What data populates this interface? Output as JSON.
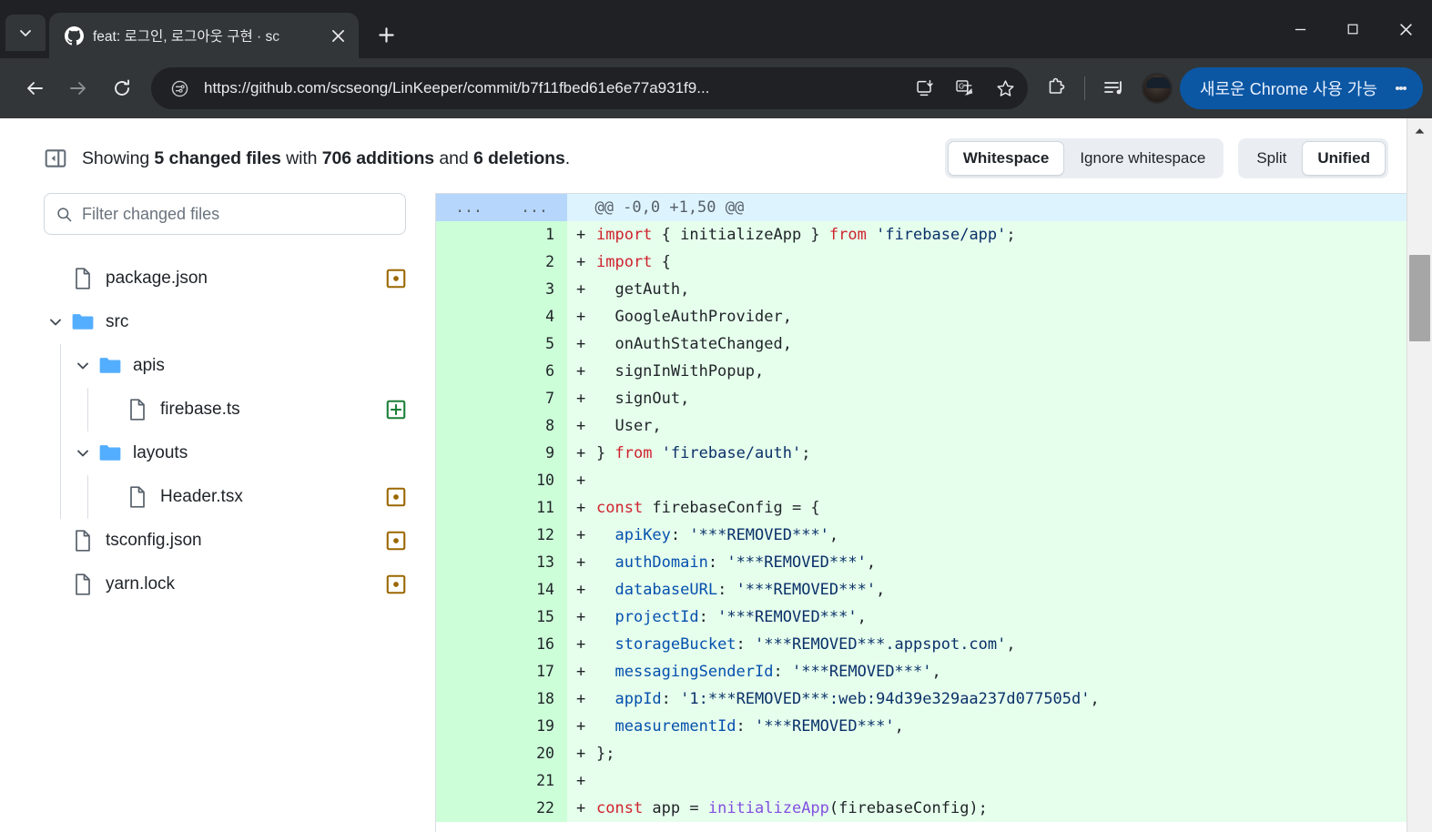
{
  "browser": {
    "tab": {
      "title": "feat: 로그인, 로그아웃 구현 · sc",
      "favicon": "github-icon"
    },
    "new_tab_label": "+",
    "omnibox": {
      "url": "https://github.com/scseong/LinKeeper/commit/b7f11fbed61e6e77a931f9...",
      "site_info_icon": "page-info-icon"
    },
    "toolbar_icons": [
      "install-app-icon",
      "translate-icon",
      "bookmark-star-icon",
      "extensions-icon",
      "media-controls-icon"
    ],
    "profile": "profile-avatar",
    "new_chrome_button": "새로운 Chrome 사용 가능",
    "window_controls": {
      "minimize": "minimize-icon",
      "maximize": "maximize-icon",
      "close": "close-icon"
    }
  },
  "header": {
    "summary_prefix": "Showing ",
    "changed_files": "5 changed files",
    "summary_mid": " with ",
    "additions": "706 additions",
    "summary_and": " and ",
    "deletions": "6 deletions",
    "summary_end": ".",
    "whitespace_group": [
      {
        "label": "Whitespace",
        "active": true
      },
      {
        "label": "Ignore whitespace",
        "active": false
      }
    ],
    "view_group": [
      {
        "label": "Split",
        "active": false
      },
      {
        "label": "Unified",
        "active": true
      }
    ]
  },
  "sidebar": {
    "filter_placeholder": "Filter changed files",
    "items": [
      {
        "name": "package.json",
        "type": "file",
        "depth": 0,
        "status": "modified"
      },
      {
        "name": "src",
        "type": "folder",
        "depth": 0,
        "expanded": true,
        "status": "none"
      },
      {
        "name": "apis",
        "type": "folder",
        "depth": 1,
        "expanded": true,
        "status": "none"
      },
      {
        "name": "firebase.ts",
        "type": "file",
        "depth": 2,
        "status": "added"
      },
      {
        "name": "layouts",
        "type": "folder",
        "depth": 1,
        "expanded": true,
        "status": "none"
      },
      {
        "name": "Header.tsx",
        "type": "file",
        "depth": 2,
        "status": "modified"
      },
      {
        "name": "tsconfig.json",
        "type": "file",
        "depth": 0,
        "status": "modified"
      },
      {
        "name": "yarn.lock",
        "type": "file",
        "depth": 0,
        "status": "modified"
      }
    ]
  },
  "diff": {
    "hunk_header": "@@ -0,0 +1,50 @@",
    "hunk_gutter_left": "...",
    "hunk_gutter_right": "...",
    "lines": [
      {
        "n": "1",
        "mark": "+",
        "tokens": [
          [
            "k",
            "import"
          ],
          [
            "t",
            " { initializeApp } "
          ],
          [
            "k",
            "from"
          ],
          [
            "t",
            " "
          ],
          [
            "s",
            "'firebase/app'"
          ],
          [
            "t",
            ";"
          ]
        ]
      },
      {
        "n": "2",
        "mark": "+",
        "tokens": [
          [
            "k",
            "import"
          ],
          [
            "t",
            " {"
          ]
        ]
      },
      {
        "n": "3",
        "mark": "+",
        "tokens": [
          [
            "t",
            "  getAuth,"
          ]
        ]
      },
      {
        "n": "4",
        "mark": "+",
        "tokens": [
          [
            "t",
            "  GoogleAuthProvider,"
          ]
        ]
      },
      {
        "n": "5",
        "mark": "+",
        "tokens": [
          [
            "t",
            "  onAuthStateChanged,"
          ]
        ]
      },
      {
        "n": "6",
        "mark": "+",
        "tokens": [
          [
            "t",
            "  signInWithPopup,"
          ]
        ]
      },
      {
        "n": "7",
        "mark": "+",
        "tokens": [
          [
            "t",
            "  signOut,"
          ]
        ]
      },
      {
        "n": "8",
        "mark": "+",
        "tokens": [
          [
            "t",
            "  User,"
          ]
        ]
      },
      {
        "n": "9",
        "mark": "+",
        "tokens": [
          [
            "t",
            "} "
          ],
          [
            "k",
            "from"
          ],
          [
            "t",
            " "
          ],
          [
            "s",
            "'firebase/auth'"
          ],
          [
            "t",
            ";"
          ]
        ]
      },
      {
        "n": "10",
        "mark": "+",
        "tokens": [
          [
            "t",
            ""
          ]
        ]
      },
      {
        "n": "11",
        "mark": "+",
        "tokens": [
          [
            "k",
            "const"
          ],
          [
            "t",
            " firebaseConfig = {"
          ]
        ]
      },
      {
        "n": "12",
        "mark": "+",
        "tokens": [
          [
            "t",
            "  "
          ],
          [
            "p",
            "apiKey"
          ],
          [
            "t",
            ": "
          ],
          [
            "s",
            "'***REMOVED***'"
          ],
          [
            "t",
            ","
          ]
        ]
      },
      {
        "n": "13",
        "mark": "+",
        "tokens": [
          [
            "t",
            "  "
          ],
          [
            "p",
            "authDomain"
          ],
          [
            "t",
            ": "
          ],
          [
            "s",
            "'***REMOVED***'"
          ],
          [
            "t",
            ","
          ]
        ]
      },
      {
        "n": "14",
        "mark": "+",
        "tokens": [
          [
            "t",
            "  "
          ],
          [
            "p",
            "databaseURL"
          ],
          [
            "t",
            ": "
          ],
          [
            "s",
            "'***REMOVED***'"
          ],
          [
            "t",
            ","
          ]
        ]
      },
      {
        "n": "15",
        "mark": "+",
        "tokens": [
          [
            "t",
            "  "
          ],
          [
            "p",
            "projectId"
          ],
          [
            "t",
            ": "
          ],
          [
            "s",
            "'***REMOVED***'"
          ],
          [
            "t",
            ","
          ]
        ]
      },
      {
        "n": "16",
        "mark": "+",
        "tokens": [
          [
            "t",
            "  "
          ],
          [
            "p",
            "storageBucket"
          ],
          [
            "t",
            ": "
          ],
          [
            "s",
            "'***REMOVED***.appspot.com'"
          ],
          [
            "t",
            ","
          ]
        ]
      },
      {
        "n": "17",
        "mark": "+",
        "tokens": [
          [
            "t",
            "  "
          ],
          [
            "p",
            "messagingSenderId"
          ],
          [
            "t",
            ": "
          ],
          [
            "s",
            "'***REMOVED***'"
          ],
          [
            "t",
            ","
          ]
        ]
      },
      {
        "n": "18",
        "mark": "+",
        "tokens": [
          [
            "t",
            "  "
          ],
          [
            "p",
            "appId"
          ],
          [
            "t",
            ": "
          ],
          [
            "s",
            "'1:***REMOVED***:web:94d39e329aa237d077505d'"
          ],
          [
            "t",
            ","
          ]
        ]
      },
      {
        "n": "19",
        "mark": "+",
        "tokens": [
          [
            "t",
            "  "
          ],
          [
            "p",
            "measurementId"
          ],
          [
            "t",
            ": "
          ],
          [
            "s",
            "'***REMOVED***'"
          ],
          [
            "t",
            ","
          ]
        ]
      },
      {
        "n": "20",
        "mark": "+",
        "tokens": [
          [
            "t",
            "};"
          ]
        ]
      },
      {
        "n": "21",
        "mark": "+",
        "tokens": [
          [
            "t",
            ""
          ]
        ]
      },
      {
        "n": "22",
        "mark": "+",
        "tokens": [
          [
            "k",
            "const"
          ],
          [
            "t",
            " app = "
          ],
          [
            "f",
            "initializeApp"
          ],
          [
            "t",
            "(firebaseConfig);"
          ]
        ]
      }
    ]
  },
  "colors": {
    "added_bg": "#e6ffec",
    "added_gutter": "#ccffd8",
    "hunk_bg": "#ddf4ff",
    "hunk_gutter": "#b6d7fb",
    "keyword": "#cf222e",
    "string": "#0a3069",
    "property": "#0550ae",
    "function": "#8250df",
    "accent_blue": "#0b57a4",
    "folder_blue": "#54aeff",
    "status_modified": "#9a6700",
    "status_added": "#1a7f37"
  }
}
